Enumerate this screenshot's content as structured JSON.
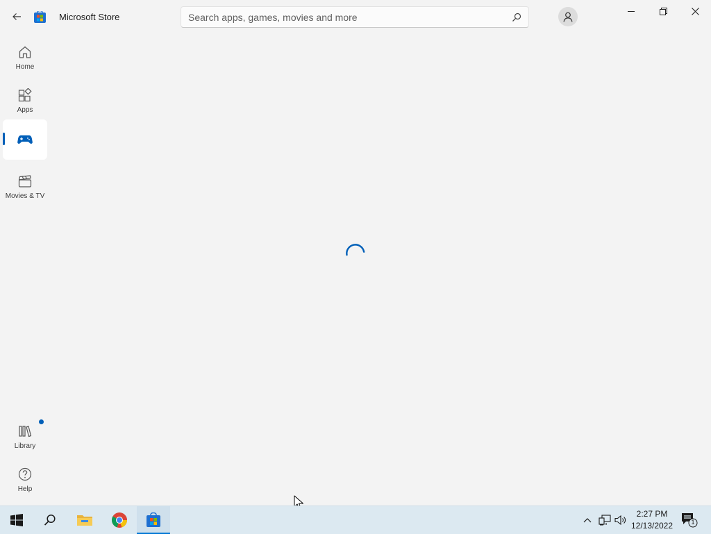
{
  "app": {
    "title": "Microsoft Store",
    "accent": "#005fb8"
  },
  "search": {
    "placeholder": "Search apps, games, movies and more",
    "value": ""
  },
  "nav": {
    "items": [
      {
        "label": "Home",
        "icon": "home-icon"
      },
      {
        "label": "Apps",
        "icon": "apps-icon"
      },
      {
        "label": "",
        "icon": "gamepad-icon",
        "selected": true
      },
      {
        "label": "Movies & TV",
        "icon": "clapperboard-icon"
      }
    ],
    "bottom": [
      {
        "label": "Library",
        "icon": "library-icon",
        "has_update_badge": true
      },
      {
        "label": "Help",
        "icon": "help-icon"
      }
    ]
  },
  "window_controls": [
    "minimize-icon",
    "restore-icon",
    "close-icon"
  ],
  "content": {
    "state": "loading"
  },
  "taskbar": {
    "pinned": [
      "windows-start-icon",
      "search-icon",
      "file-explorer-icon",
      "chrome-icon",
      "store-icon"
    ],
    "active": "store-icon",
    "clock": {
      "time": "2:27 PM",
      "date": "12/13/2022"
    },
    "notifications_count": "1"
  }
}
